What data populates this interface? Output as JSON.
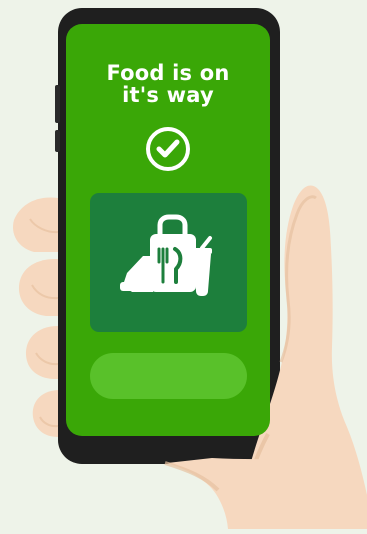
{
  "screen": {
    "title": "Food is on\nit's way",
    "check_icon": "check-circle-icon",
    "food_icon": "food-delivery-icon"
  },
  "colors": {
    "background": "#eef3e9",
    "screen_green": "#3aa707",
    "card_green": "#1d7f3c",
    "pill_green": "#59c12a",
    "phone_frame": "#1f1f1f",
    "skin": "#f6d8bf"
  }
}
